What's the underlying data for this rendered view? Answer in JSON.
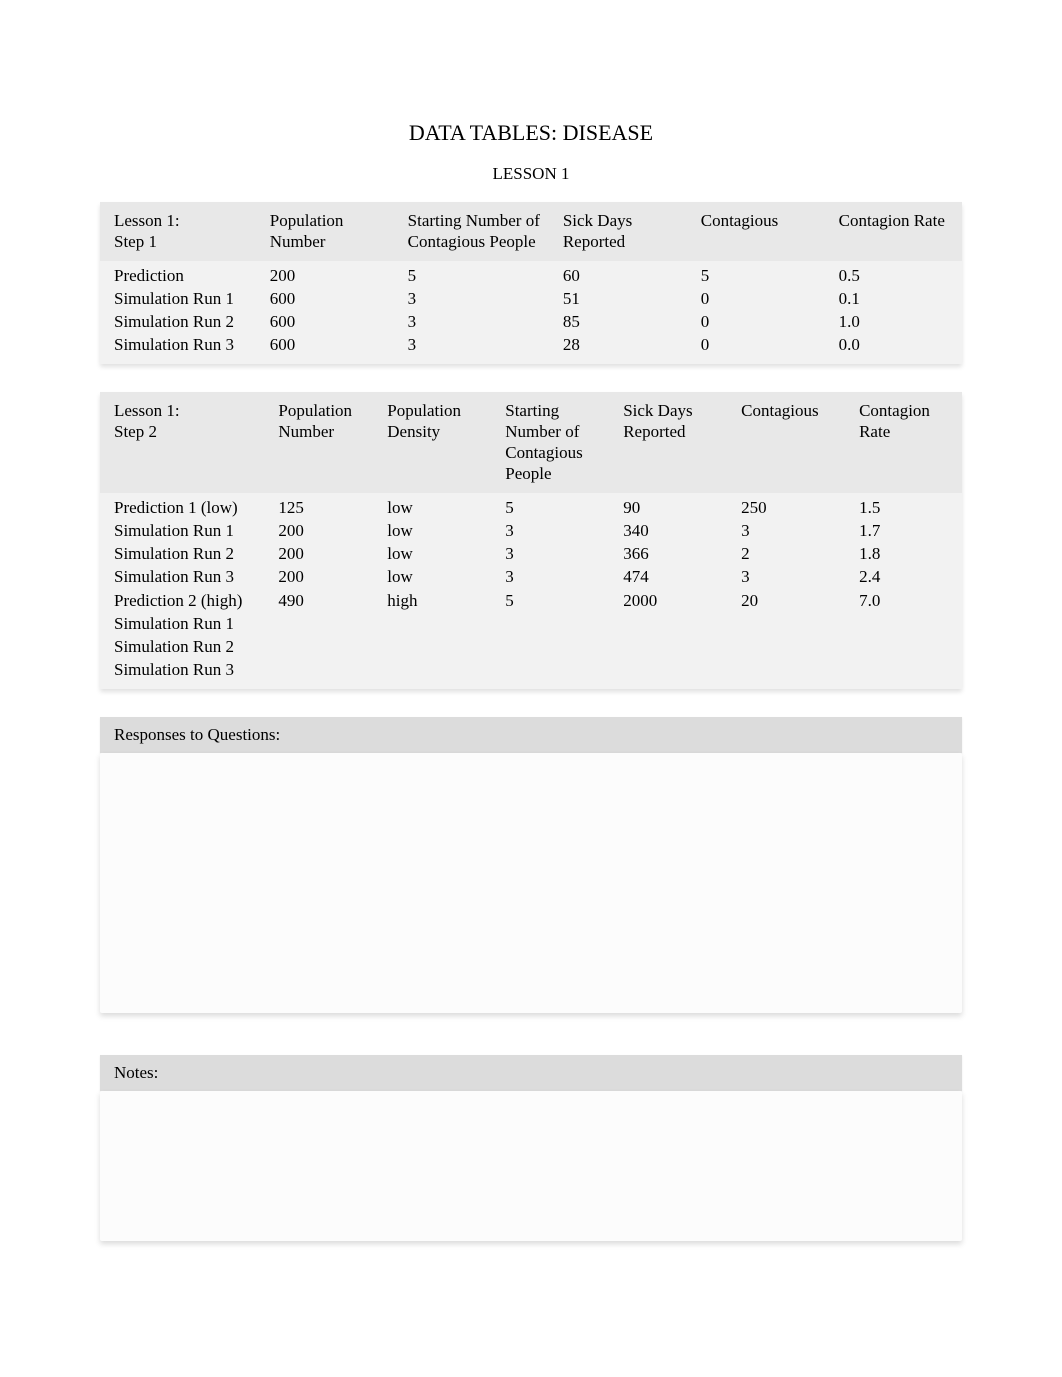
{
  "title": "DATA TABLES: DISEASE",
  "subtitle": "LESSON 1",
  "table1": {
    "headers": {
      "c0": "Lesson 1:\nStep 1",
      "c1": "Population Number",
      "c2": "Starting Number of Contagious People",
      "c3": "Sick Days Reported",
      "c4": "Contagious",
      "c5": "Contagion Rate"
    },
    "rows": [
      {
        "c0": "Prediction",
        "c1": "200",
        "c2": "5",
        "c3": "60",
        "c4": "5",
        "c5": "0.5"
      },
      {
        "c0": "Simulation Run 1",
        "c1": "600",
        "c2": "3",
        "c3": "51",
        "c4": "0",
        "c5": "0.1"
      },
      {
        "c0": "Simulation Run 2",
        "c1": "600",
        "c2": "3",
        "c3": "85",
        "c4": "0",
        "c5": "1.0"
      },
      {
        "c0": "Simulation Run 3",
        "c1": "600",
        "c2": "3",
        "c3": "28",
        "c4": "0",
        "c5": "0.0"
      }
    ]
  },
  "table2": {
    "headers": {
      "c0": "Lesson 1:\nStep 2",
      "c1": "Population Number",
      "c2": "Population Density",
      "c3": "Starting Number of Contagious People",
      "c4": "Sick Days Reported",
      "c5": "Contagious",
      "c6": "Contagion Rate"
    },
    "rows": [
      {
        "c0": "Prediction 1 (low)",
        "c1": "125",
        "c2": "low",
        "c3": "5",
        "c4": "90",
        "c5": "250",
        "c6": "1.5"
      },
      {
        "c0": "Simulation Run 1",
        "c1": "200",
        "c2": "low",
        "c3": "3",
        "c4": "340",
        "c5": "3",
        "c6": "1.7"
      },
      {
        "c0": "Simulation Run 2",
        "c1": "200",
        "c2": "low",
        "c3": "3",
        "c4": "366",
        "c5": "2",
        "c6": "1.8"
      },
      {
        "c0": "Simulation Run 3",
        "c1": "200",
        "c2": "low",
        "c3": "3",
        "c4": "474",
        "c5": "3",
        "c6": "2.4"
      },
      {
        "c0": "Prediction 2 (high)",
        "c1": "490",
        "c2": "high",
        "c3": "5",
        "c4": "2000",
        "c5": "20",
        "c6": "7.0"
      },
      {
        "c0": "Simulation Run 1",
        "c1": "",
        "c2": "",
        "c3": "",
        "c4": "",
        "c5": "",
        "c6": ""
      },
      {
        "c0": "Simulation Run 2",
        "c1": "",
        "c2": "",
        "c3": "",
        "c4": "",
        "c5": "",
        "c6": ""
      },
      {
        "c0": "Simulation Run 3",
        "c1": "",
        "c2": "",
        "c3": "",
        "c4": "",
        "c5": "",
        "c6": ""
      }
    ]
  },
  "responses_label": "Responses to Questions:",
  "notes_label": "Notes:"
}
